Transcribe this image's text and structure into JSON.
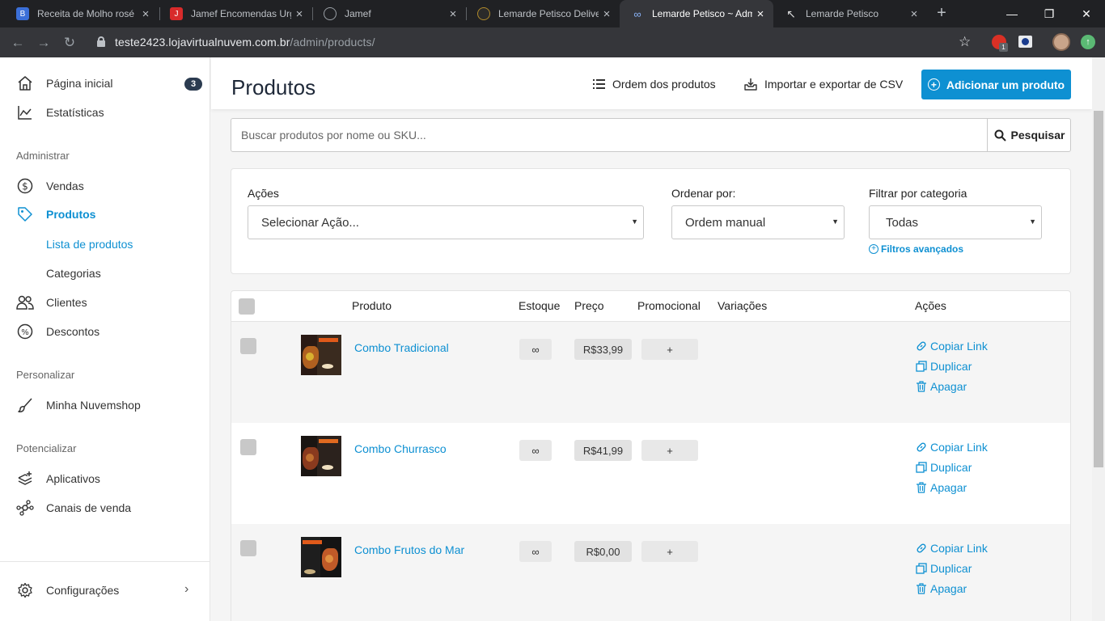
{
  "browser": {
    "tabs": [
      {
        "title": "Receita de Molho rosé",
        "favicon": "blogger-icon",
        "color": "#3b6fd8"
      },
      {
        "title": "Jamef Encomendas Urg",
        "favicon": "jamef-icon",
        "color": "#d82b2b"
      },
      {
        "title": "Jamef",
        "favicon": "globe-icon",
        "color": "#9aa0a6"
      },
      {
        "title": "Lemarde Petisco Delive",
        "favicon": "store-icon",
        "color": "#b08a2a"
      },
      {
        "title": "Lemarde Petisco ~ Adm",
        "favicon": "nuvemshop-icon",
        "color": "#8ab4f8"
      },
      {
        "title": "Lemarde Petisco",
        "favicon": "store-icon",
        "color": "#111111"
      }
    ],
    "url_host": "teste2423.lojavirtualnuvem.com.br",
    "url_path": "/admin/products/",
    "extension_badge": "1"
  },
  "sidebar": {
    "home": "Página inicial",
    "home_badge": "3",
    "stats": "Estatísticas",
    "section_admin": "Administrar",
    "sales": "Vendas",
    "products": "Produtos",
    "product_list": "Lista de produtos",
    "categories": "Categorias",
    "clients": "Clientes",
    "discounts": "Descontos",
    "section_customize": "Personalizar",
    "my_store": "Minha Nuvemshop",
    "section_boost": "Potencializar",
    "apps": "Aplicativos",
    "sales_channels": "Canais de venda",
    "settings": "Configurações"
  },
  "header": {
    "title": "Produtos",
    "order_link": "Ordem dos produtos",
    "import_link": "Importar e exportar de CSV",
    "add_button": "Adicionar um produto"
  },
  "search": {
    "placeholder": "Buscar produtos por nome ou SKU...",
    "button": "Pesquisar"
  },
  "filters": {
    "actions_label": "Ações",
    "actions_value": "Selecionar Ação...",
    "sort_label": "Ordenar por:",
    "sort_value": "Ordem manual",
    "category_label": "Filtrar por categoria",
    "category_value": "Todas",
    "advanced": "Filtros avançados"
  },
  "table": {
    "columns": {
      "product": "Produto",
      "stock": "Estoque",
      "price": "Preço",
      "promo": "Promocional",
      "variations": "Variações",
      "actions": "Ações"
    },
    "rows": [
      {
        "name": "Combo Tradicional",
        "stock": "∞",
        "price": "R$33,99",
        "promo": "+"
      },
      {
        "name": "Combo Churrasco",
        "stock": "∞",
        "price": "R$41,99",
        "promo": "+"
      },
      {
        "name": "Combo Frutos do Mar",
        "stock": "∞",
        "price": "R$0,00",
        "promo": "+"
      }
    ],
    "row_actions": {
      "copy": "Copiar Link",
      "duplicate": "Duplicar",
      "delete": "Apagar"
    }
  },
  "colors": {
    "accent": "#0e90d2",
    "sidebar_badge": "#2b3b50"
  }
}
